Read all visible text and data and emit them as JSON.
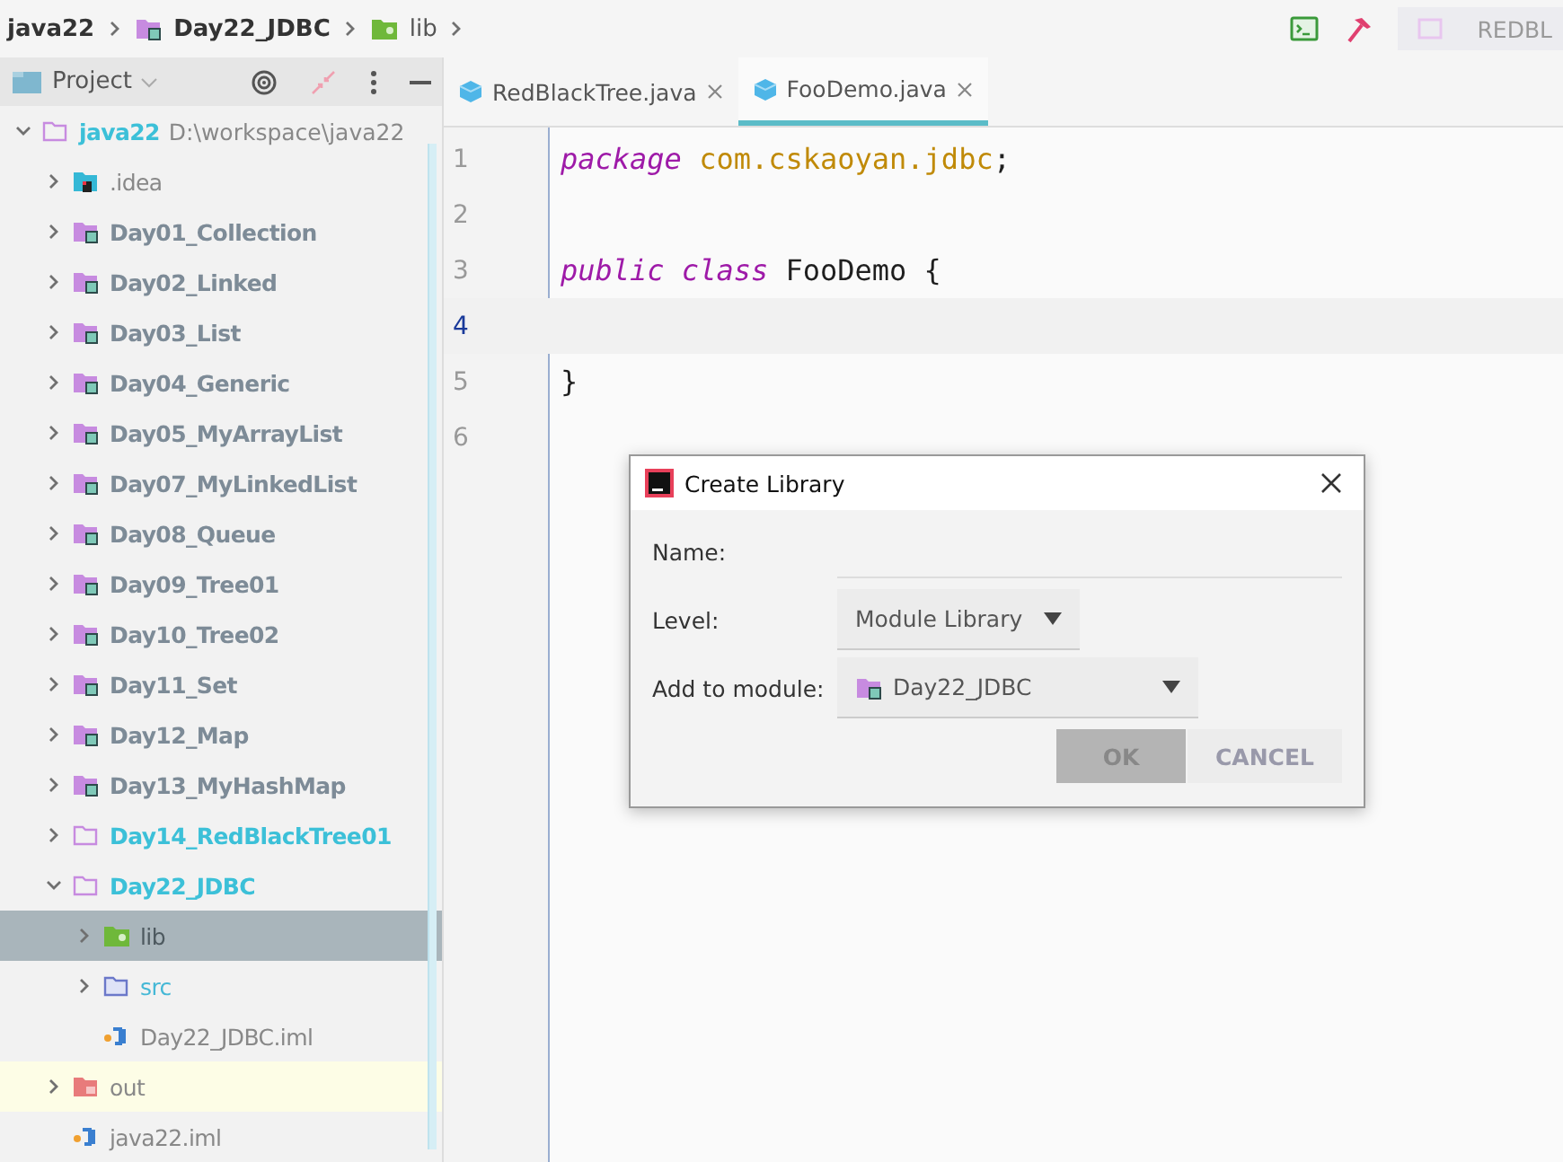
{
  "breadcrumbs": [
    {
      "label": "java22",
      "kind": "project"
    },
    {
      "label": "Day22_JDBC",
      "kind": "module"
    },
    {
      "label": "lib",
      "kind": "lib"
    }
  ],
  "toolbar": {
    "run_config": "REDBL"
  },
  "project_panel": {
    "title": "Project",
    "tree": [
      {
        "label": "java22",
        "path": "D:\\workspace\\java22",
        "kind": "root",
        "expanded": true,
        "selected": false,
        "children": [
          {
            "label": ".idea",
            "kind": "idea",
            "expanded": false,
            "selected": false
          },
          {
            "label": "Day01_Collection",
            "kind": "module",
            "expanded": false,
            "selected": false
          },
          {
            "label": "Day02_Linked",
            "kind": "module",
            "expanded": false,
            "selected": false
          },
          {
            "label": "Day03_List",
            "kind": "module",
            "expanded": false,
            "selected": false
          },
          {
            "label": "Day04_Generic",
            "kind": "module",
            "expanded": false,
            "selected": false
          },
          {
            "label": "Day05_MyArrayList",
            "kind": "module",
            "expanded": false,
            "selected": false
          },
          {
            "label": "Day07_MyLinkedList",
            "kind": "module",
            "expanded": false,
            "selected": false
          },
          {
            "label": "Day08_Queue",
            "kind": "module",
            "expanded": false,
            "selected": false
          },
          {
            "label": "Day09_Tree01",
            "kind": "module",
            "expanded": false,
            "selected": false
          },
          {
            "label": "Day10_Tree02",
            "kind": "module",
            "expanded": false,
            "selected": false
          },
          {
            "label": "Day11_Set",
            "kind": "module",
            "expanded": false,
            "selected": false
          },
          {
            "label": "Day12_Map",
            "kind": "module",
            "expanded": false,
            "selected": false
          },
          {
            "label": "Day13_MyHashMap",
            "kind": "module",
            "expanded": false,
            "selected": false
          },
          {
            "label": "Day14_RedBlackTree01",
            "kind": "folder",
            "expanded": false,
            "selected": false
          },
          {
            "label": "Day22_JDBC",
            "kind": "folder",
            "expanded": true,
            "selected": false,
            "children": [
              {
                "label": "lib",
                "kind": "lib",
                "expanded": false,
                "selected": true
              },
              {
                "label": "src",
                "kind": "src",
                "expanded": false,
                "selected": false
              },
              {
                "label": "Day22_JDBC.iml",
                "kind": "iml",
                "selected": false
              }
            ]
          },
          {
            "label": "out",
            "kind": "out",
            "expanded": false,
            "selected": false
          },
          {
            "label": "java22.iml",
            "kind": "iml",
            "selected": false
          }
        ]
      }
    ]
  },
  "tabs": [
    {
      "label": "RedBlackTree.java",
      "selected": false
    },
    {
      "label": "FooDemo.java",
      "selected": true
    }
  ],
  "editor": {
    "lines": [
      {
        "number": "1",
        "current": false,
        "tokens": [
          {
            "text": "package",
            "kind": "keyword"
          },
          {
            "text": " com.cskaoyan.jdbc",
            "kind": "package"
          },
          {
            "text": ";",
            "kind": "plain"
          }
        ]
      },
      {
        "number": "2",
        "current": false
      },
      {
        "number": "3",
        "current": false,
        "tokens": [
          {
            "text": "public class",
            "kind": "keyword"
          },
          {
            "text": " FooDemo {",
            "kind": "plain"
          }
        ]
      },
      {
        "number": "4",
        "current": true
      },
      {
        "number": "5",
        "current": false,
        "tokens": [
          {
            "text": "}",
            "kind": "plain"
          }
        ]
      },
      {
        "number": "6",
        "current": false
      }
    ]
  },
  "dialog": {
    "title": "Create Library",
    "fields": [
      {
        "label": "Name:",
        "kind": "text"
      },
      {
        "label": "Level:",
        "kind": "combo",
        "value": "Module Library"
      },
      {
        "label": "Add to module:",
        "kind": "module-combo",
        "value": "Day22_JDBC"
      }
    ],
    "buttons": [
      {
        "label": "OK",
        "pressed": true
      },
      {
        "label": "CANCEL",
        "pressed": false
      }
    ]
  }
}
